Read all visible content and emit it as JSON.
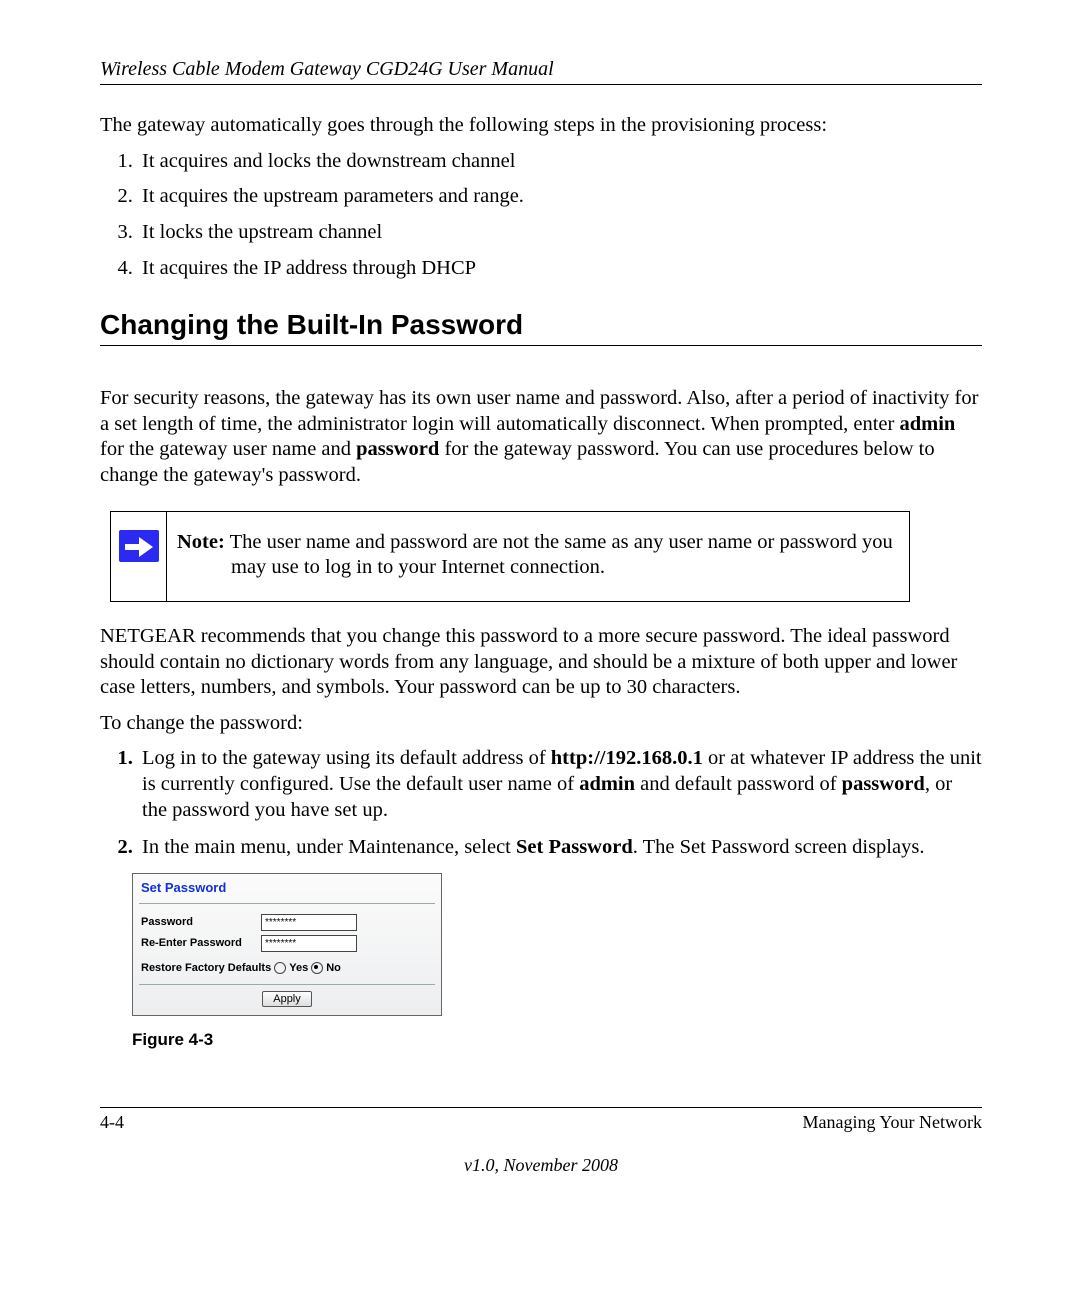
{
  "header": {
    "title": "Wireless Cable Modem Gateway CGD24G User Manual"
  },
  "intro": "The gateway automatically goes through the following steps in the provisioning process:",
  "steps": [
    "It acquires and locks the downstream channel",
    "It acquires the upstream parameters and range.",
    "It locks the upstream channel",
    "It acquires the IP address through DHCP"
  ],
  "section_heading": "Changing the Built-In Password",
  "para_security_pre": "For security reasons, the gateway has its own user name and password. Also, after a period of inactivity for a set length of time, the administrator login will automatically disconnect. When prompted, enter ",
  "bold_admin": "admin",
  "para_security_mid": " for the gateway user name and ",
  "bold_password": "password",
  "para_security_end": " for the gateway password. You can use procedures below to change the gateway's password.",
  "note": {
    "bold": "Note:",
    "line1": " The user name and password are not the same as any user name or password you",
    "line2": "may use to log in to your Internet connection."
  },
  "netgear_para": "NETGEAR recommends that you change this password to a more secure password. The ideal password should contain no dictionary words from any language, and should be a mixture of both upper and lower case letters, numbers, and symbols. Your password can be up to 30 characters.",
  "to_change": "To change the password:",
  "step1": {
    "pre": "Log in to the gateway using its default address of ",
    "url": "http://192.168.0.1",
    "mid": " or at whatever IP address the unit is currently configured. Use the default user name of ",
    "admin": "admin",
    "mid2": " and default password of ",
    "pass": "password",
    "end": ", or the password you have set up."
  },
  "step2": {
    "pre": "In the main menu, under Maintenance, select ",
    "bold": "Set Password",
    "end": ". The Set Password screen displays."
  },
  "figure": {
    "title": "Set Password",
    "label_password": "Password",
    "label_reenter": "Re-Enter Password",
    "masked": "********",
    "restore": "Restore Factory Defaults",
    "yes": "Yes",
    "no": "No",
    "apply": "Apply",
    "caption": "Figure 4-3"
  },
  "footer": {
    "page_num": "4-4",
    "section": "Managing Your Network",
    "version": "v1.0, November 2008"
  }
}
